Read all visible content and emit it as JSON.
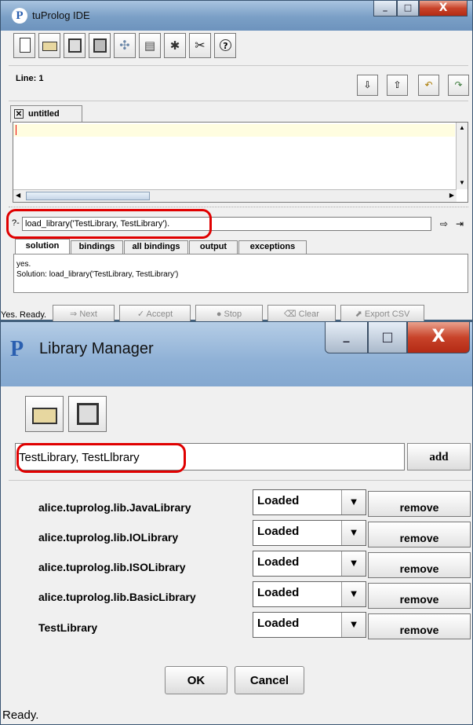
{
  "ide": {
    "title": "tuProlog IDE",
    "line_indicator": "Line: 1",
    "file_tab": "untitled",
    "query_prompt": "?-",
    "query_value": "load_library('TestLibrary, TestLibrary').",
    "result_tabs": [
      "solution",
      "bindings",
      "all bindings",
      "output",
      "exceptions"
    ],
    "solution_lines": [
      "yes.",
      "Solution: load_library('TestLibrary, TestLibrary')"
    ],
    "buttons": {
      "next": "Next",
      "accept": "Accept",
      "stop": "Stop",
      "clear": "Clear",
      "export": "Export CSV"
    },
    "status": "Yes. Ready."
  },
  "libmgr": {
    "title": "Library Manager",
    "input_value": "TestLibrary, TestLlbrary",
    "add_label": "add",
    "libraries": [
      {
        "name": "alice.tuprolog.lib.JavaLibrary",
        "state": "Loaded",
        "action": "remove"
      },
      {
        "name": "alice.tuprolog.lib.IOLibrary",
        "state": "Loaded",
        "action": "remove"
      },
      {
        "name": "alice.tuprolog.lib.ISOLibrary",
        "state": "Loaded",
        "action": "remove"
      },
      {
        "name": "alice.tuprolog.lib.BasicLibrary",
        "state": "Loaded",
        "action": "remove"
      },
      {
        "name": "TestLibrary",
        "state": "Loaded",
        "action": "remove"
      }
    ],
    "ok_label": "OK",
    "cancel_label": "Cancel",
    "status": "Ready."
  },
  "colors": {
    "title_bar": "#7a9fc6",
    "close_button": "#c8432a",
    "highlight": "#e00000",
    "editor_line": "#fffde0"
  }
}
